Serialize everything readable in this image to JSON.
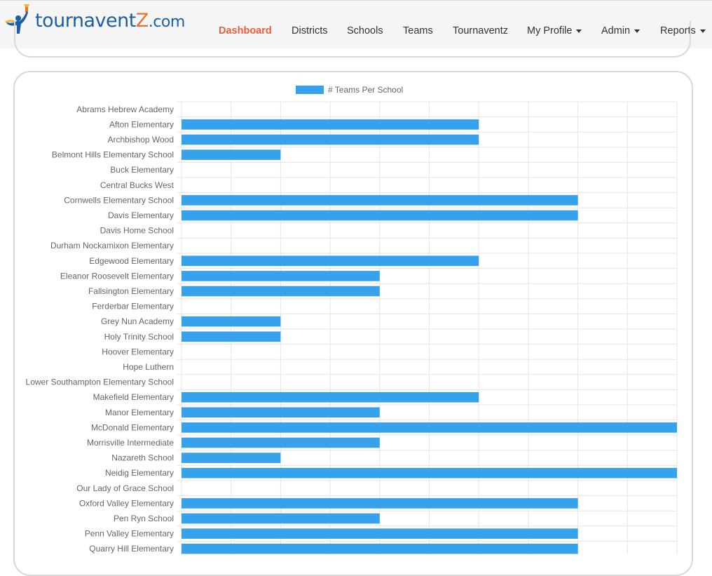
{
  "brand": {
    "logo_text_main": "tournavent",
    "logo_text_z": "Z",
    "logo_text_com": ".com"
  },
  "nav": {
    "items": [
      {
        "label": "Dashboard",
        "active": true,
        "dropdown": false
      },
      {
        "label": "Districts",
        "active": false,
        "dropdown": false
      },
      {
        "label": "Schools",
        "active": false,
        "dropdown": false
      },
      {
        "label": "Teams",
        "active": false,
        "dropdown": false
      },
      {
        "label": "Tournaventz",
        "active": false,
        "dropdown": false
      },
      {
        "label": "My Profile",
        "active": false,
        "dropdown": true
      },
      {
        "label": "Admin",
        "active": false,
        "dropdown": true
      },
      {
        "label": "Reports",
        "active": false,
        "dropdown": true
      }
    ]
  },
  "colors": {
    "accent": "#e8603c",
    "bar": "#36a2eb",
    "grid": "#e5e5e5",
    "label": "#666666"
  },
  "chart_data": {
    "type": "bar",
    "orientation": "horizontal",
    "legend": {
      "label": "# Teams Per School",
      "position": "top"
    },
    "grid": true,
    "xlim": [
      0,
      10
    ],
    "categories": [
      "Abrams Hebrew Academy",
      "Afton Elementary",
      "Archbishop Wood",
      "Belmont Hills Elementary School",
      "Buck Elementary",
      "Central Bucks West",
      "Cornwells Elementary School",
      "Davis Elementary",
      "Davis Home School",
      "Durham Nockamixon Elementary",
      "Edgewood Elementary",
      "Eleanor Roosevelt Elementary",
      "Fallsington Elementary",
      "Ferderbar Elementary",
      "Grey Nun Academy",
      "Holy Trinity School",
      "Hoover Elementary",
      "Hope Luthern",
      "Lower Southampton Elementary School",
      "Makefield Elementary",
      "Manor Elementary",
      "McDonald Elementary",
      "Morrisville Intermediate",
      "Nazareth School",
      "Neidig Elementary",
      "Our Lady of Grace School",
      "Oxford Valley Elementary",
      "Pen Ryn School",
      "Penn Valley Elementary",
      "Quarry Hill Elementary"
    ],
    "values": [
      0,
      6,
      6,
      2,
      0,
      0,
      8,
      8,
      0,
      0,
      6,
      4,
      4,
      0,
      2,
      2,
      0,
      0,
      0,
      6,
      4,
      10,
      4,
      2,
      10,
      0,
      8,
      4,
      8,
      8
    ]
  }
}
